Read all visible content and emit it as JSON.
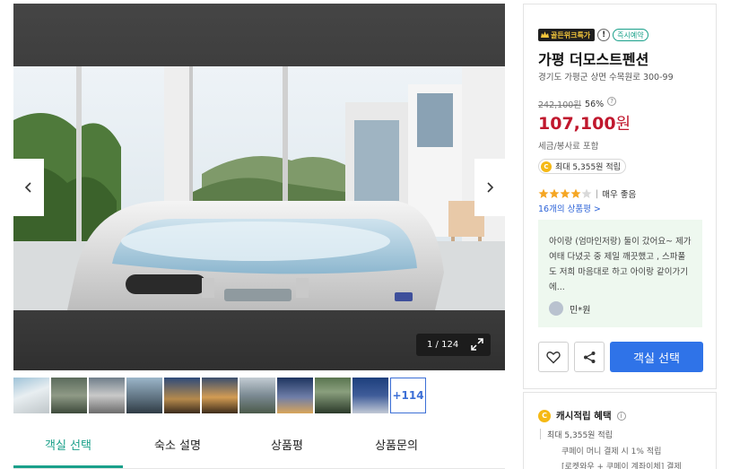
{
  "gallery": {
    "counter": "1 / 124",
    "prev_icon": "chevron-left-icon",
    "next_icon": "chevron-right-icon",
    "expand_icon": "expand-icon"
  },
  "thumbnails": {
    "more_label": "+114"
  },
  "tabs": [
    {
      "label": "객실 선택",
      "active": true
    },
    {
      "label": "숙소 설명",
      "active": false
    },
    {
      "label": "상품평",
      "active": false
    },
    {
      "label": "상품문의",
      "active": false
    }
  ],
  "product": {
    "badge_goldenweek": "골든위크특가",
    "badge_info": "!",
    "badge_instant": "즉시예약",
    "title": "가평 더모스트펜션",
    "address": "경기도 가평군 상면 수목원로 300-99",
    "original_price": "242,100원",
    "discount": "56%",
    "price": "107,100",
    "price_unit": "원",
    "tax_note": "세금/봉사료 포함",
    "points": "최대 5,355원 적립",
    "rating_stars": 4,
    "rating_label": "매우 좋음",
    "review_count_link": "16개의 상품평 >",
    "review_text": "아이랑 (엄마인저랑) 둘이 갔어요~ 제가 여태 다녔곳 중 제일 깨끗했고 , 스파풀도 저희 마음대로 하고 아이랑 같이가기에...",
    "reviewer": "민*원",
    "select_button": "객실 선택",
    "accent_color": "#c0172d",
    "brand_color": "#2f73e8"
  },
  "cashback": {
    "title": "캐시적립 혜택",
    "line1": "최대 5,355원 적립",
    "line2": "쿠페이 머니 결제 시 1% 적립",
    "line3": "[로켓와우 + 쿠페이 계좌이체] 결제"
  }
}
